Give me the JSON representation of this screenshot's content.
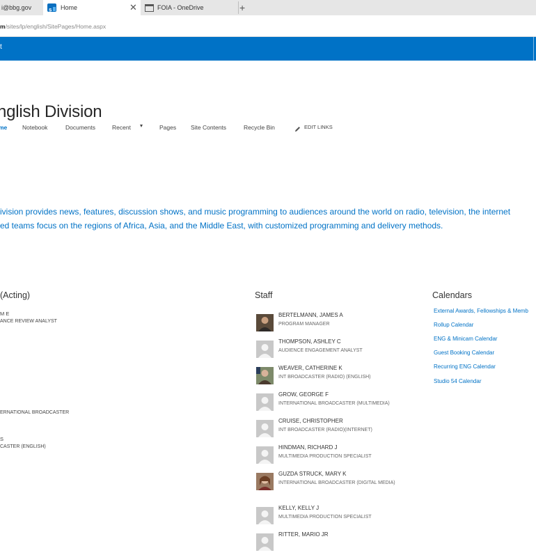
{
  "browser": {
    "tabs": [
      {
        "label": "i@bbg.gov"
      },
      {
        "label": "Home",
        "close": "✕"
      },
      {
        "label": "FOIA - OneDrive"
      }
    ],
    "new_tab": "+",
    "address": {
      "bold": "m",
      "rest": "/sites/lp/english/SitePages/Home.aspx"
    }
  },
  "suite_bar": {
    "glyph": "t",
    "color": "#0072c6"
  },
  "site": {
    "title": "nglish Division",
    "nav": [
      {
        "label": "me",
        "current": true
      },
      {
        "label": "Notebook"
      },
      {
        "label": "Documents"
      },
      {
        "label": "Recent"
      },
      {
        "label": "Pages"
      },
      {
        "label": "Site Contents"
      },
      {
        "label": "Recycle Bin"
      }
    ],
    "recent_caret": "▾",
    "edit_links": "EDIT LINKS"
  },
  "description": [
    "ivision provides news, features, discussion shows, and music programming to audiences around the world on radio, television, the internet",
    "ed teams focus on the regions of Africa, Asia, and the Middle East, with customized programming and delivery methods."
  ],
  "left_section": {
    "heading": "(Acting)",
    "lines": [
      {
        "text": "M E"
      },
      {
        "text": "ANCE REVIEW ANALYST"
      },
      {
        "text": "ERNATIONAL BROADCASTER"
      },
      {
        "text": "S"
      },
      {
        "text": "CASTER (ENGLISH)"
      }
    ]
  },
  "staff": {
    "heading": "Staff",
    "people": [
      {
        "name": "BERTELMANN, JAMES A",
        "role": "PROGRAM MANAGER",
        "photo": "photo"
      },
      {
        "name": "THOMPSON, ASHLEY C",
        "role": "AUDIENCE ENGAGEMENT ANALYST",
        "photo": "placeholder"
      },
      {
        "name": "WEAVER, CATHERINE K",
        "role": "INT BROADCASTER (RADIO) (ENGLISH)",
        "photo": "photo"
      },
      {
        "name": "GROW, GEORGE F",
        "role": "INTERNATIONAL BROADCASTER (MULTIMEDIA)",
        "photo": "placeholder"
      },
      {
        "name": "CRUISE, CHRISTOPHER",
        "role": "INT BROADCASTER (RADIO)(INTERNET)",
        "photo": "placeholder"
      },
      {
        "name": "HINDMAN, RICHARD J",
        "role": "MULTIMEDIA PRODUCTION SPECIALIST",
        "photo": "placeholder"
      },
      {
        "name": "GUZDA STRUCK, MARY K",
        "role": "INTERNATIONAL BROADCASTER (DIGITAL MEDIA)",
        "photo": "photo"
      },
      {
        "name": "KELLY, KELLY J",
        "role": "MULTIMEDIA PRODUCTION SPECIALIST",
        "photo": "placeholder"
      },
      {
        "name": "RITTER, MARIO JR",
        "role": "",
        "photo": "placeholder"
      }
    ]
  },
  "calendars": {
    "heading": "Calendars",
    "links": [
      {
        "label": "External Awards, Fellowships & Memb"
      },
      {
        "label": "Rollup Calendar"
      },
      {
        "label": "ENG & Minicam Calendar"
      },
      {
        "label": "Guest Booking Calendar"
      },
      {
        "label": "Recurring ENG Calendar"
      },
      {
        "label": "Studio 54 Calendar"
      }
    ]
  }
}
